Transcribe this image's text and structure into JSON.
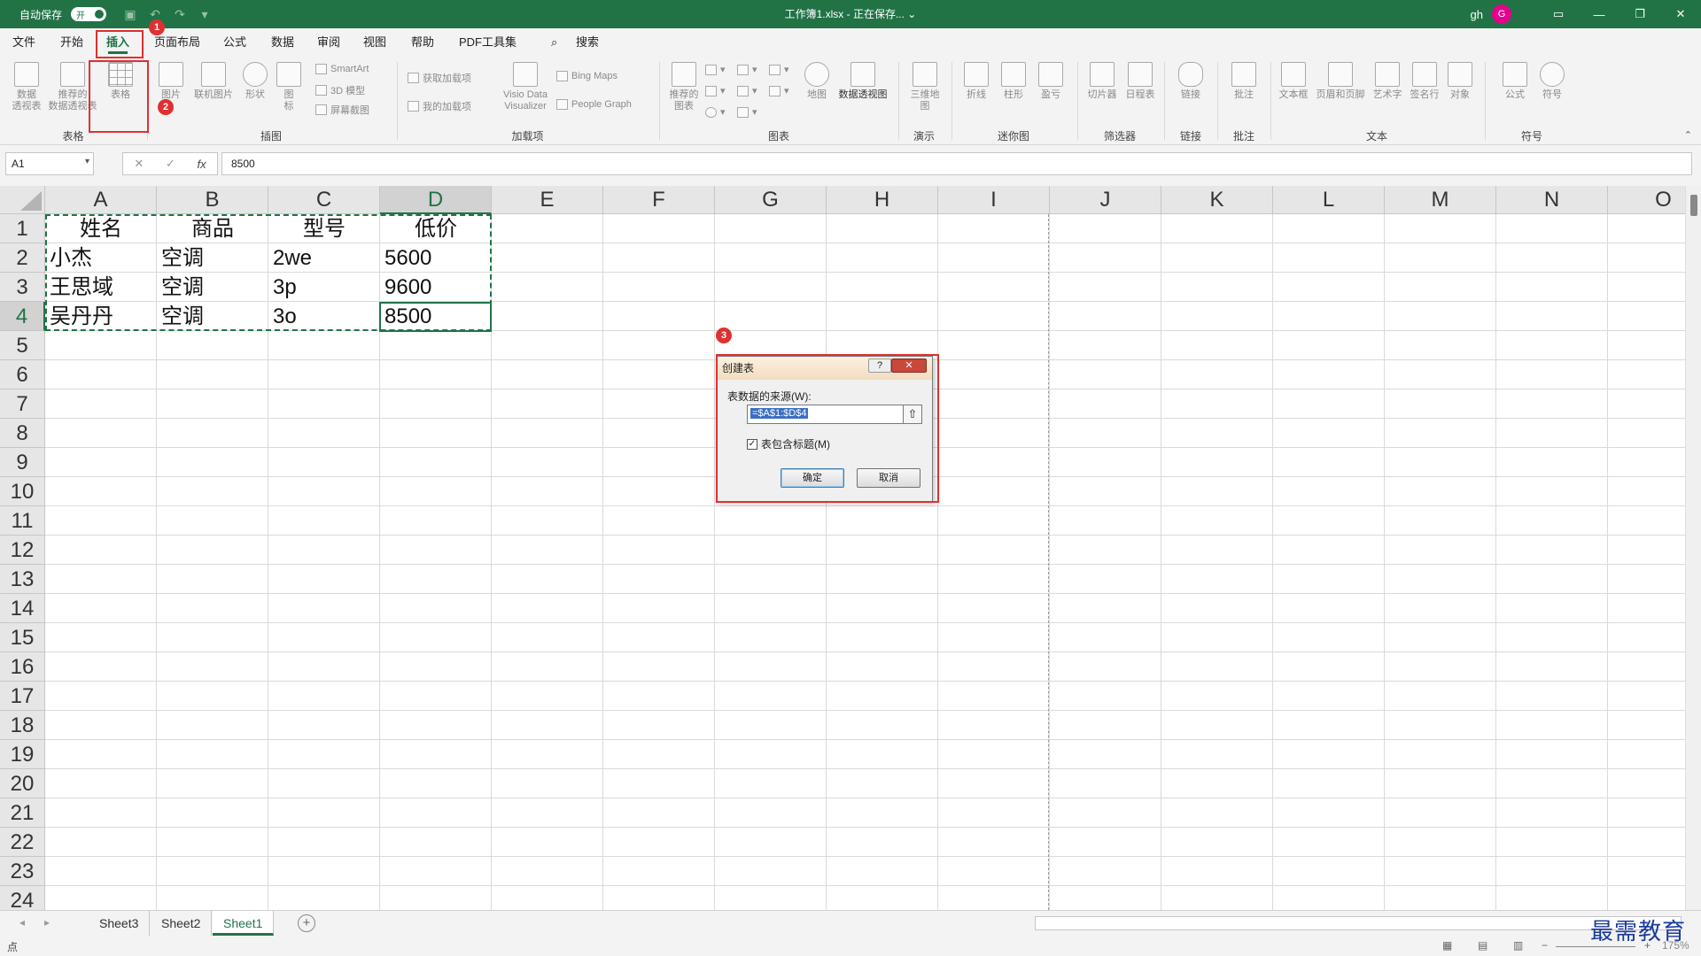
{
  "titlebar": {
    "autosave_label": "自动保存",
    "autosave_state": "开",
    "title": "工作簿1.xlsx - 正在保存... ⌄",
    "user": "gh",
    "avatar_letter": "G"
  },
  "menu": [
    "文件",
    "开始",
    "插入",
    "页面布局",
    "公式",
    "数据",
    "审阅",
    "视图",
    "帮助",
    "PDF工具集",
    "搜索"
  ],
  "ribbon": {
    "pivot": "数据\n透视表",
    "rec_pivot": "推荐的\n数据透视表",
    "table": "表格",
    "picture": "图片",
    "online_picture": "联机图片",
    "shapes": "形状",
    "icons": "图\n标",
    "smartart": "SmartArt",
    "model3d": "3D 模型",
    "screenshot": "屏幕截图",
    "get_addins": "获取加载项",
    "my_addins": "我的加载项",
    "visio": "Visio Data\nVisualizer",
    "bing_maps": "Bing Maps",
    "people_graph": "People Graph",
    "rec_charts": "推荐的\n图表",
    "maps": "地图",
    "pivot_chart": "数据透视图",
    "map3d": "三维地\n图",
    "line": "折线",
    "column": "柱形",
    "winloss": "盈亏",
    "slicer": "切片器",
    "timeline": "日程表",
    "link": "链接",
    "comment": "批注",
    "textbox": "文本框",
    "header_footer": "页眉和页脚",
    "wordart": "艺术字",
    "signature": "签名行",
    "object": "对象",
    "equation": "公式",
    "symbol": "符号",
    "groups": {
      "tables": "表格",
      "illustrations": "插图",
      "addins": "加载项",
      "charts": "图表",
      "tours": "演示",
      "sparklines": "迷你图",
      "filters": "筛选器",
      "links": "链接",
      "comments": "批注",
      "text": "文本",
      "symbols": "符号"
    }
  },
  "formula_bar": {
    "name_box": "A1",
    "formula": "8500",
    "fx": "fx"
  },
  "columns": [
    "A",
    "B",
    "C",
    "D",
    "E",
    "F",
    "G",
    "H",
    "I",
    "J",
    "K",
    "L",
    "M",
    "N",
    "O"
  ],
  "rows": [
    "1",
    "2",
    "3",
    "4",
    "5",
    "6",
    "7",
    "8",
    "9",
    "10",
    "11",
    "12",
    "13",
    "14",
    "15",
    "16",
    "17",
    "18",
    "19",
    "20",
    "21",
    "22",
    "23",
    "24"
  ],
  "cells": [
    [
      "姓名",
      "商品",
      "型号",
      "低价"
    ],
    [
      "小杰",
      "空调",
      "2we",
      "5600"
    ],
    [
      "王思域",
      "空调",
      "3p",
      "9600"
    ],
    [
      "吴丹丹",
      "空调",
      "3o",
      "8500"
    ]
  ],
  "dialog": {
    "title": "创建表",
    "help": "?",
    "close": "✕",
    "source_label": "表数据的来源(W):",
    "range": "=$A$1:$D$4",
    "header_checkbox": "表包含标题(M)",
    "header_checked": true,
    "ok": "确定",
    "cancel": "取消"
  },
  "sheets": [
    "Sheet3",
    "Sheet2",
    "Sheet1"
  ],
  "active_sheet": "Sheet1",
  "status": "点",
  "zoom": "175%",
  "watermark": "最需教育",
  "annotations": [
    "1",
    "2",
    "3"
  ]
}
